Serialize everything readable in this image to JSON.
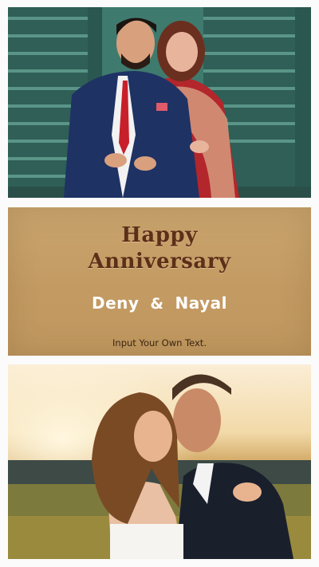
{
  "card": {
    "title_line1": "Happy",
    "title_line2": "Anniversary",
    "name_left": "Deny",
    "ampersand": "&",
    "name_right": "Nayal",
    "subtext": "Input Your Own Text."
  },
  "colors": {
    "card_background": "#c49c64",
    "title_color": "#5c2f18",
    "names_color": "#ffffff",
    "subtext_color": "#3a2612"
  }
}
